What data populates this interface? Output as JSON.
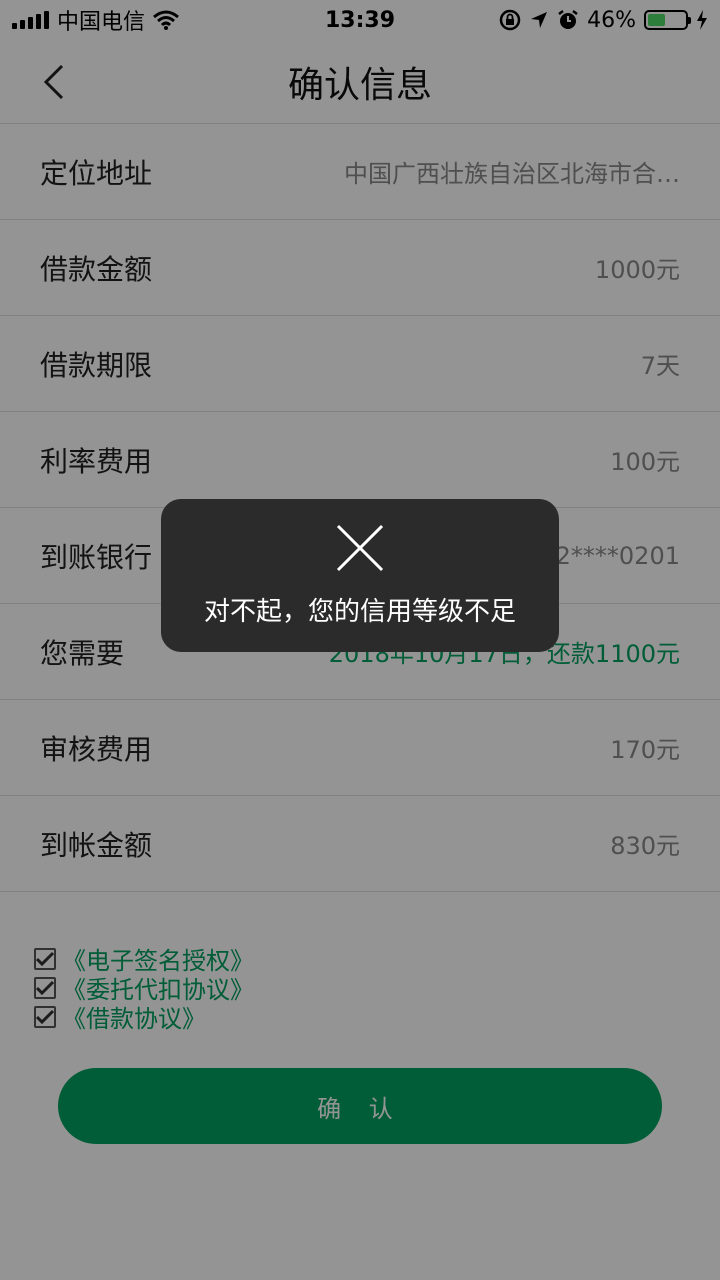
{
  "status_bar": {
    "carrier": "中国电信",
    "time": "13:39",
    "battery": "46%",
    "battery_level": 0.46
  },
  "nav": {
    "title": "确认信息"
  },
  "rows": [
    {
      "label": "定位地址",
      "value": "中国广西壮族自治区北海市合…"
    },
    {
      "label": "借款金额",
      "value": "1000元"
    },
    {
      "label": "借款期限",
      "value": "7天"
    },
    {
      "label": "利率费用",
      "value": "100元"
    },
    {
      "label": "到账银行",
      "value": "22****0201"
    },
    {
      "label": "您需要",
      "value": "2018年10月17日，还款1100元"
    },
    {
      "label": "审核费用",
      "value": "170元"
    },
    {
      "label": "到帐金额",
      "value": "830元"
    }
  ],
  "agreements": [
    {
      "label": "《电子签名授权》",
      "checked": true
    },
    {
      "label": "《委托代扣协议》",
      "checked": true
    },
    {
      "label": "《借款协议》",
      "checked": true
    }
  ],
  "confirm_button": "确 认",
  "toast": {
    "icon": "close-icon",
    "message": "对不起，您的信用等级不足"
  },
  "colors": {
    "accent": "#00a060",
    "toast_bg": "#2b2b2b"
  }
}
